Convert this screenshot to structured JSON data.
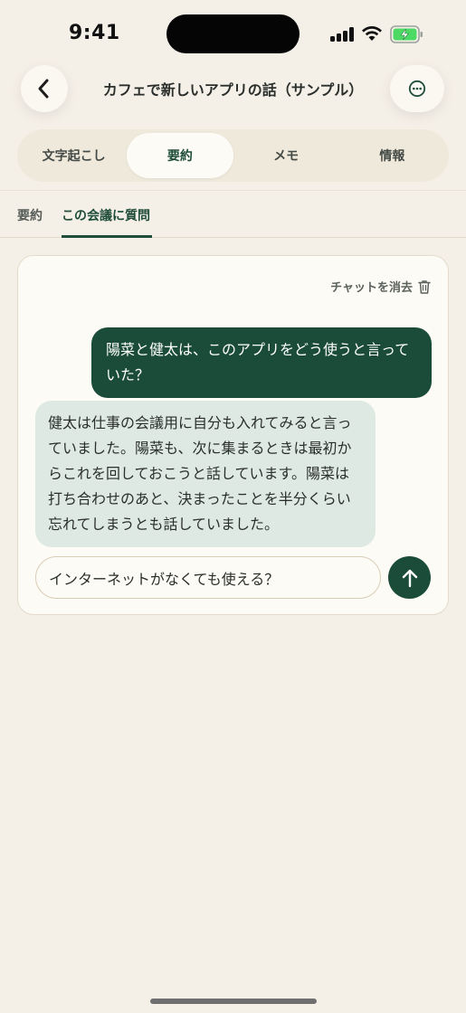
{
  "status_bar": {
    "time": "9:41",
    "icons": [
      "signal-icon",
      "wifi-icon",
      "battery-charging-icon"
    ]
  },
  "header": {
    "title": "カフェで新しいアプリの話（サンプル）",
    "back_icon": "chevron-left-icon",
    "more_icon": "ellipsis-circle-icon"
  },
  "segments": [
    {
      "label": "文字起こし",
      "active": false
    },
    {
      "label": "要約",
      "active": true
    },
    {
      "label": "メモ",
      "active": false
    },
    {
      "label": "情報",
      "active": false
    }
  ],
  "subtabs": [
    {
      "label": "要約",
      "active": false
    },
    {
      "label": "この会議に質問",
      "active": true
    }
  ],
  "chat": {
    "clear_label": "チャットを消去",
    "clear_icon": "trash-icon",
    "messages": [
      {
        "role": "user",
        "text": "陽菜と健太は、このアプリをどう使うと言っていた？"
      },
      {
        "role": "assistant",
        "text": "健太は仕事の会議用に自分も入れてみると言っていました。陽菜も、次に集まるときは最初からこれを回しておこうと話しています。陽菜は打ち合わせのあと、決まったことを半分くらい忘れてしまうとも話していました。"
      }
    ],
    "input_value": "インターネットがなくても使える？",
    "send_icon": "arrow-up-icon"
  },
  "colors": {
    "background": "#f4efe7",
    "accent": "#1b4c3a",
    "assistant_bubble": "#dde9e2",
    "battery": "#4cd964"
  }
}
